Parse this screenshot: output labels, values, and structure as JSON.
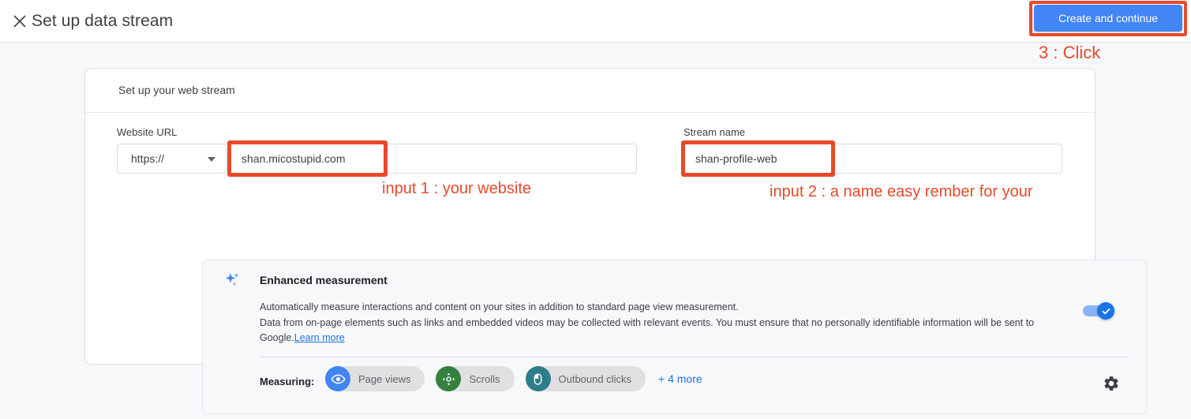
{
  "header": {
    "close_icon": "close-icon",
    "title": "Set up data stream",
    "primary_button": "Create and continue"
  },
  "annotations": {
    "click_step": "3 : Click",
    "input1": "input 1 : your website",
    "input2": "input 2 : a name easy rember for your",
    "color": "#e8492b"
  },
  "card": {
    "section_title": "Set up your web stream",
    "website_url": {
      "label": "Website URL",
      "protocol_value": "https://",
      "url_value": "shan.micostupid.com",
      "url_placeholder": ""
    },
    "stream_name": {
      "label": "Stream name",
      "value": "shan-profile-web",
      "placeholder": ""
    }
  },
  "enhanced_measurement": {
    "icon": "sparkle-icon",
    "title": "Enhanced measurement",
    "description_line1": "Automatically measure interactions and content on your sites in addition to standard page view measurement.",
    "description_line2": "Data from on-page elements such as links and embedded videos may be collected with relevant events. You must ensure that no personally identifiable information will be sent to",
    "description_line3": "Google.",
    "learn_more": "Learn more",
    "toggle_state": "on",
    "toggle_color": "#1a73e8",
    "measuring_label": "Measuring:",
    "chips": [
      {
        "label": "Page views",
        "icon": "eye-icon",
        "color": "#4285f4"
      },
      {
        "label": "Scrolls",
        "icon": "scroll-move-icon",
        "color": "#33803f"
      },
      {
        "label": "Outbound clicks",
        "icon": "mouse-icon",
        "color": "#2e7d8a"
      }
    ],
    "more_link": "+ 4 more",
    "settings_icon": "gear-icon"
  }
}
